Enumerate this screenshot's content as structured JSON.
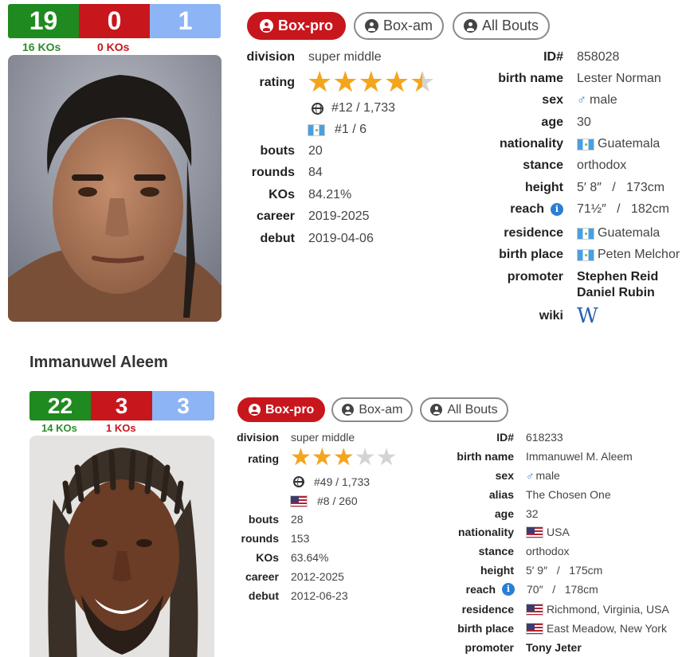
{
  "boxers": [
    {
      "record": {
        "wins": "19",
        "losses": "0",
        "draws": "1",
        "win_kos": "16 KOs",
        "loss_kos": "0 KOs"
      },
      "buttons": {
        "pro": "Box-pro",
        "am": "Box-am",
        "all": "All Bouts"
      },
      "left": {
        "division_label": "division",
        "division": "super middle",
        "rating_label": "rating",
        "rating_stars": 4.5,
        "world_rank": "#12 / 1,733",
        "national_rank": "#1 / 6",
        "bouts_label": "bouts",
        "bouts": "20",
        "rounds_label": "rounds",
        "rounds": "84",
        "kos_label": "KOs",
        "kos": "84.21%",
        "career_label": "career",
        "career": "2019-2025",
        "debut_label": "debut",
        "debut": "2019-04-06"
      },
      "right": {
        "id_label": "ID#",
        "id": "858028",
        "birth_name_label": "birth name",
        "birth_name": "Lester Norman",
        "sex_label": "sex",
        "sex": "male",
        "age_label": "age",
        "age": "30",
        "nationality_label": "nationality",
        "nationality": "Guatemala",
        "stance_label": "stance",
        "stance": "orthodox",
        "height_label": "height",
        "height": "5′ 8″   /   173cm",
        "reach_label": "reach",
        "reach": "71½″   /   182cm",
        "residence_label": "residence",
        "residence": "Guatemala",
        "birth_place_label": "birth place",
        "birth_place": "Peten Melchor",
        "promoter_label": "promoter",
        "promoter_1": "Stephen Reid",
        "promoter_2": "Daniel Rubin",
        "wiki_label": "wiki",
        "wiki_icon": "W"
      }
    },
    {
      "name": "Immanuwel Aleem",
      "record": {
        "wins": "22",
        "losses": "3",
        "draws": "3",
        "win_kos": "14 KOs",
        "loss_kos": "1 KOs"
      },
      "buttons": {
        "pro": "Box-pro",
        "am": "Box-am",
        "all": "All Bouts"
      },
      "left": {
        "division_label": "division",
        "division": "super middle",
        "rating_label": "rating",
        "rating_stars": 3,
        "world_rank": "#49 / 1,733",
        "national_rank": "#8 / 260",
        "bouts_label": "bouts",
        "bouts": "28",
        "rounds_label": "rounds",
        "rounds": "153",
        "kos_label": "KOs",
        "kos": "63.64%",
        "career_label": "career",
        "career": "2012-2025",
        "debut_label": "debut",
        "debut": "2012-06-23"
      },
      "right": {
        "id_label": "ID#",
        "id": "618233",
        "birth_name_label": "birth name",
        "birth_name": "Immanuwel M. Aleem",
        "sex_label": "sex",
        "sex": "male",
        "alias_label": "alias",
        "alias": "The Chosen One",
        "age_label": "age",
        "age": "32",
        "nationality_label": "nationality",
        "nationality": "USA",
        "stance_label": "stance",
        "stance": "orthodox",
        "height_label": "height",
        "height": "5′ 9″   /   175cm",
        "reach_label": "reach",
        "reach": "70″   /   178cm",
        "residence_label": "residence",
        "residence": "Richmond, Virginia, USA",
        "birth_place_label": "birth place",
        "birth_place": "East Meadow, New York",
        "promoter_label": "promoter",
        "promoter": "Tony Jeter"
      }
    }
  ],
  "colors": {
    "win": "#1f8a1f",
    "loss": "#c8161d",
    "draw": "#8db4f5",
    "star": "#f5a51b",
    "accent": "#c8161d"
  },
  "icons": [
    "user-circle-icon",
    "globe-icon",
    "flag-guatemala-icon",
    "flag-usa-icon",
    "male-icon",
    "info-icon",
    "wikipedia-icon"
  ]
}
